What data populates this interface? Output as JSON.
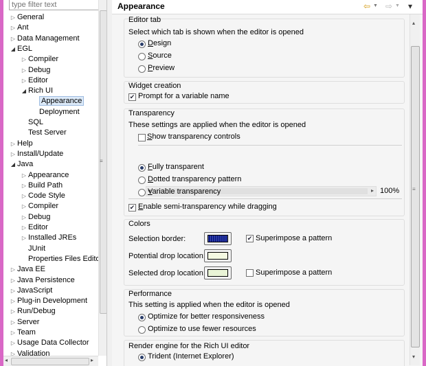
{
  "filter_placeholder": "type filter text",
  "tree": [
    {
      "label": "General",
      "level": 0,
      "toggle": "closed"
    },
    {
      "label": "Ant",
      "level": 0,
      "toggle": "closed"
    },
    {
      "label": "Data Management",
      "level": 0,
      "toggle": "closed"
    },
    {
      "label": "EGL",
      "level": 0,
      "toggle": "open"
    },
    {
      "label": "Compiler",
      "level": 1,
      "toggle": "closed"
    },
    {
      "label": "Debug",
      "level": 1,
      "toggle": "closed"
    },
    {
      "label": "Editor",
      "level": 1,
      "toggle": "closed"
    },
    {
      "label": "Rich UI",
      "level": 1,
      "toggle": "open"
    },
    {
      "label": "Appearance",
      "level": 2,
      "toggle": "none",
      "selected": true
    },
    {
      "label": "Deployment",
      "level": 2,
      "toggle": "none"
    },
    {
      "label": "SQL",
      "level": 1,
      "toggle": "none"
    },
    {
      "label": "Test Server",
      "level": 1,
      "toggle": "none"
    },
    {
      "label": "Help",
      "level": 0,
      "toggle": "closed"
    },
    {
      "label": "Install/Update",
      "level": 0,
      "toggle": "closed"
    },
    {
      "label": "Java",
      "level": 0,
      "toggle": "open"
    },
    {
      "label": "Appearance",
      "level": 1,
      "toggle": "closed"
    },
    {
      "label": "Build Path",
      "level": 1,
      "toggle": "closed"
    },
    {
      "label": "Code Style",
      "level": 1,
      "toggle": "closed"
    },
    {
      "label": "Compiler",
      "level": 1,
      "toggle": "closed"
    },
    {
      "label": "Debug",
      "level": 1,
      "toggle": "closed"
    },
    {
      "label": "Editor",
      "level": 1,
      "toggle": "closed"
    },
    {
      "label": "Installed JREs",
      "level": 1,
      "toggle": "closed"
    },
    {
      "label": "JUnit",
      "level": 1,
      "toggle": "none"
    },
    {
      "label": "Properties Files Edito",
      "level": 1,
      "toggle": "none"
    },
    {
      "label": "Java EE",
      "level": 0,
      "toggle": "closed"
    },
    {
      "label": "Java Persistence",
      "level": 0,
      "toggle": "closed"
    },
    {
      "label": "JavaScript",
      "level": 0,
      "toggle": "closed"
    },
    {
      "label": "Plug-in Development",
      "level": 0,
      "toggle": "closed"
    },
    {
      "label": "Run/Debug",
      "level": 0,
      "toggle": "closed"
    },
    {
      "label": "Server",
      "level": 0,
      "toggle": "closed"
    },
    {
      "label": "Team",
      "level": 0,
      "toggle": "closed"
    },
    {
      "label": "Usage Data Collector",
      "level": 0,
      "toggle": "closed"
    },
    {
      "label": "Validation",
      "level": 0,
      "toggle": "closed"
    }
  ],
  "header": {
    "title": "Appearance",
    "back": "⇦",
    "forward": "⇨",
    "menu": "▾"
  },
  "editor_tab": {
    "title": "Editor tab",
    "desc": "Select which tab is shown when the editor is opened",
    "options": [
      {
        "key": "D",
        "rest": "esign",
        "checked": true
      },
      {
        "key": "S",
        "rest": "ource",
        "checked": false
      },
      {
        "key": "P",
        "rest": "review",
        "checked": false
      }
    ]
  },
  "widget_creation": {
    "title": "Widget creation",
    "prompt_label": "Prompt for a variable name",
    "prompt_checked": true
  },
  "transparency": {
    "title": "Transparency",
    "desc": "These settings are applied when the editor is opened",
    "show_controls_key": "S",
    "show_controls_rest": "how transparency controls",
    "show_controls_checked": false,
    "options": [
      {
        "key": "F",
        "rest": "ully transparent",
        "checked": true
      },
      {
        "key": "D",
        "rest": "otted transparency pattern",
        "checked": false
      },
      {
        "key": "V",
        "rest": "ariable transparency",
        "checked": false
      }
    ],
    "percent": "100%",
    "level": 1.0,
    "semi_key": "E",
    "semi_rest": "nable semi-transparency while dragging",
    "semi_checked": true
  },
  "colors": {
    "title": "Colors",
    "selection_border": "Selection border:",
    "potential_drop": "Potential drop location:",
    "selected_drop": "Selected drop location:",
    "superimpose1_label": "Superimpose a pattern",
    "superimpose1_checked": true,
    "superimpose2_label": "Superimpose a pattern",
    "superimpose2_checked": false,
    "selection_color": "#0a1a8c",
    "potential_color": "#f4f9e2",
    "selected_color": "#e9f4d6"
  },
  "performance": {
    "title": "Performance",
    "desc": "This setting is applied when the editor is opened",
    "options": [
      {
        "label": "Optimize for better responsiveness",
        "checked": true
      },
      {
        "label": "Optimize to use fewer resources",
        "checked": false
      }
    ]
  },
  "render_engine": {
    "title": "Render engine for the Rich UI editor",
    "options": [
      {
        "label": "Trident (Internet Explorer)",
        "checked": true
      }
    ]
  }
}
